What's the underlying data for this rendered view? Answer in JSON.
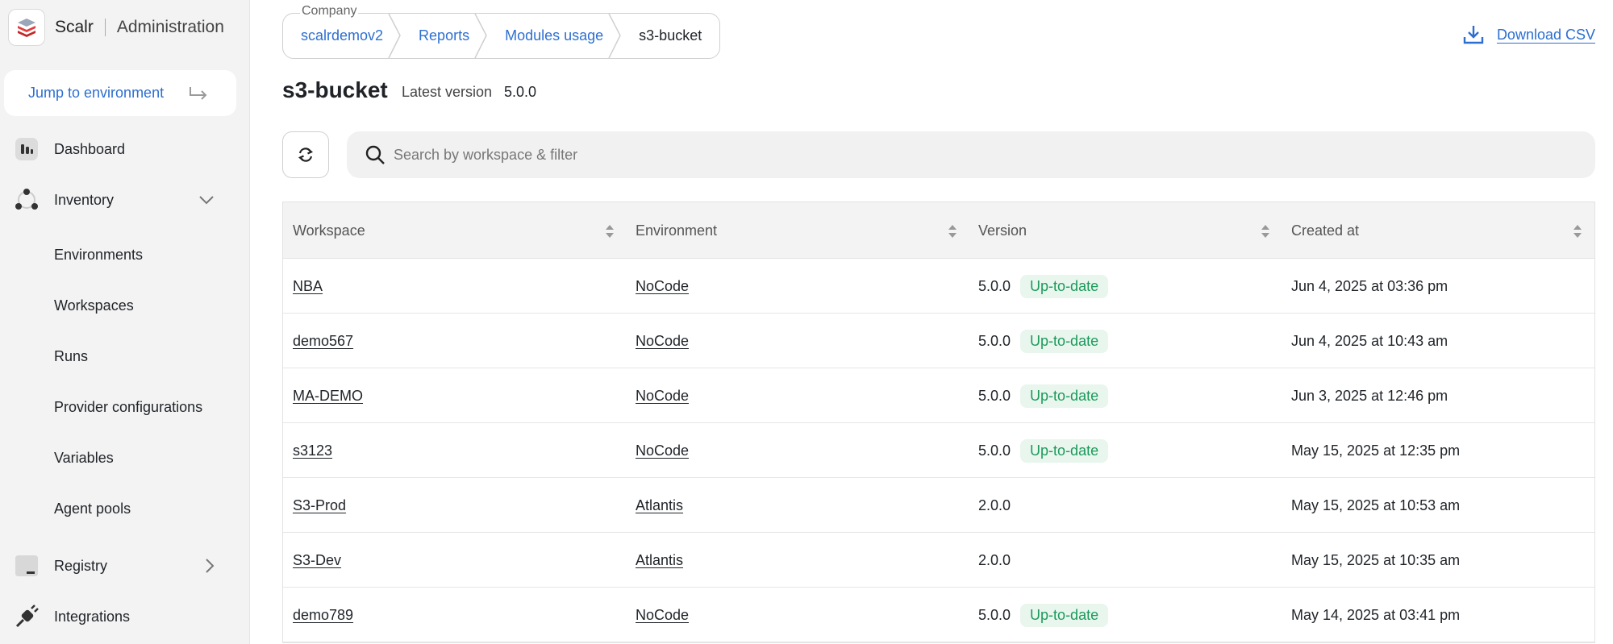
{
  "brand": {
    "name": "Scalr",
    "area": "Administration"
  },
  "sidebar": {
    "jump_label": "Jump to environment",
    "items": [
      {
        "label": "Dashboard",
        "icon": "dashboard-icon"
      },
      {
        "label": "Inventory",
        "icon": "inventory-icon"
      },
      {
        "label": "Registry",
        "icon": "registry-icon"
      },
      {
        "label": "Integrations",
        "icon": "integrations-icon"
      }
    ],
    "inventory_sub": [
      "Environments",
      "Workspaces",
      "Runs",
      "Provider configurations",
      "Variables",
      "Agent pools"
    ]
  },
  "breadcrumb": {
    "caption": "Company",
    "items": [
      "scalrdemov2",
      "Reports",
      "Modules usage",
      "s3-bucket"
    ]
  },
  "download_label": "Download CSV",
  "page": {
    "title": "s3-bucket",
    "latest_label": "Latest version",
    "latest_value": "5.0.0"
  },
  "search": {
    "placeholder": "Search by workspace & filter"
  },
  "table": {
    "headers": [
      "Workspace",
      "Environment",
      "Version",
      "Created at"
    ],
    "rows": [
      {
        "workspace": "NBA",
        "environment": "NoCode",
        "version": "5.0.0",
        "status": "Up-to-date",
        "created": "Jun 4, 2025 at 03:36 pm"
      },
      {
        "workspace": "demo567",
        "environment": "NoCode",
        "version": "5.0.0",
        "status": "Up-to-date",
        "created": "Jun 4, 2025 at 10:43 am"
      },
      {
        "workspace": "MA-DEMO",
        "environment": "NoCode",
        "version": "5.0.0",
        "status": "Up-to-date",
        "created": "Jun 3, 2025 at 12:46 pm"
      },
      {
        "workspace": "s3123",
        "environment": "NoCode",
        "version": "5.0.0",
        "status": "Up-to-date",
        "created": "May 15, 2025 at 12:35 pm"
      },
      {
        "workspace": "S3-Prod",
        "environment": "Atlantis",
        "version": "2.0.0",
        "status": "",
        "created": "May 15, 2025 at 10:53 am"
      },
      {
        "workspace": "S3-Dev",
        "environment": "Atlantis",
        "version": "2.0.0",
        "status": "",
        "created": "May 15, 2025 at 10:35 am"
      },
      {
        "workspace": "demo789",
        "environment": "NoCode",
        "version": "5.0.0",
        "status": "Up-to-date",
        "created": "May 14, 2025 at 03:41 pm"
      }
    ]
  },
  "colors": {
    "accent": "#2d6fd0",
    "success": "#1d9a5b",
    "success_bg": "#e8f6ee"
  }
}
